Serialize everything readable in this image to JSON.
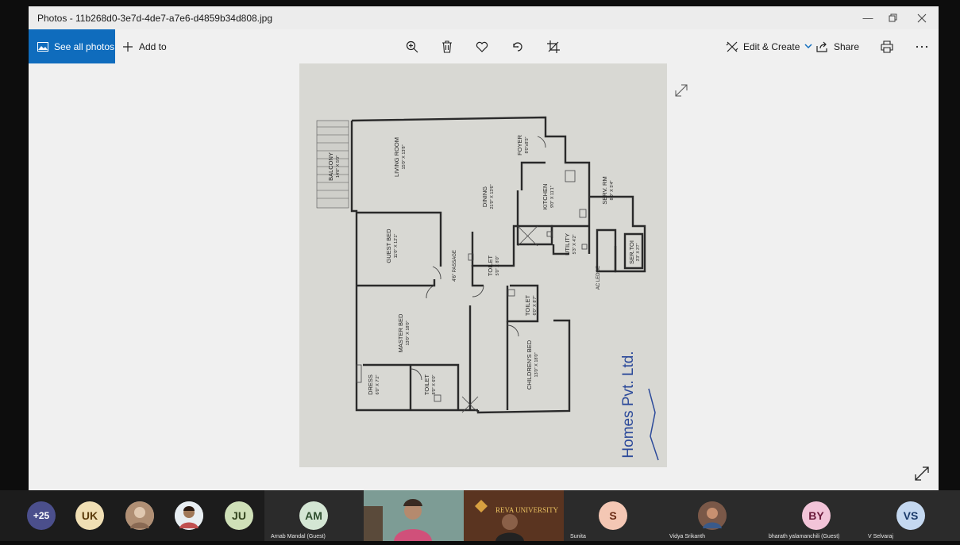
{
  "window": {
    "title": "Photos - 11b268d0-3e7d-4de7-a7e6-d4859b34d808.jpg"
  },
  "toolbar": {
    "see_all_label": "See all photos",
    "add_to_label": "Add to",
    "edit_create_label": "Edit & Create",
    "share_label": "Share"
  },
  "floorplan": {
    "rooms": [
      {
        "name": "BALCONY",
        "size": "14'0\" X 5'0\""
      },
      {
        "name": "LIVING ROOM",
        "size": "15'0\" X 13'8\""
      },
      {
        "name": "FOYER",
        "size": "8'0\"x8'5\""
      },
      {
        "name": "DINING",
        "size": "21'0\" X 13'6\""
      },
      {
        "name": "KITCHEN",
        "size": "9'0\" X 11'1\""
      },
      {
        "name": "SERV. RM",
        "size": "8'0\" X 5'4\""
      },
      {
        "name": "UTILITY",
        "size": "5'3\" X 4'2\""
      },
      {
        "name": "SER.TOI",
        "size": "3'3\" X 3'7\""
      },
      {
        "name": "GUEST BED",
        "size": "11'0\" X 12'1\""
      },
      {
        "name": "TOILET",
        "size": "5'0\" X 8'0\""
      },
      {
        "name": "MASTER BED",
        "size": "13'0\" X 18'0\""
      },
      {
        "name": "TOILET",
        "size": "6'0\" X 8'7\""
      },
      {
        "name": "CHILDREN'S BED",
        "size": "13'0\" X 18'0\""
      },
      {
        "name": "DRESS",
        "size": "6'0\" X 7'2\""
      },
      {
        "name": "TOILET",
        "size": "8'0\" X 6'0\""
      }
    ],
    "passage": "4'6\" PASSAGE",
    "ac_ledge": "AC LEDGE",
    "brand": "Homes Pvt. Ltd."
  },
  "participants": {
    "overflow": "+25",
    "uk": "UK",
    "ju": "JU",
    "am": "AM",
    "am_name": "Arnab Mandal (Guest)",
    "s": "S",
    "s_name": "Sunita",
    "vidya_name": "Vidya Srikanth",
    "by": "BY",
    "by_name": "bharath yalamanchili (Guest)",
    "vs": "VS",
    "vs_name": "V Selvaraj",
    "university_text": "REVA UNIVERSITY"
  }
}
